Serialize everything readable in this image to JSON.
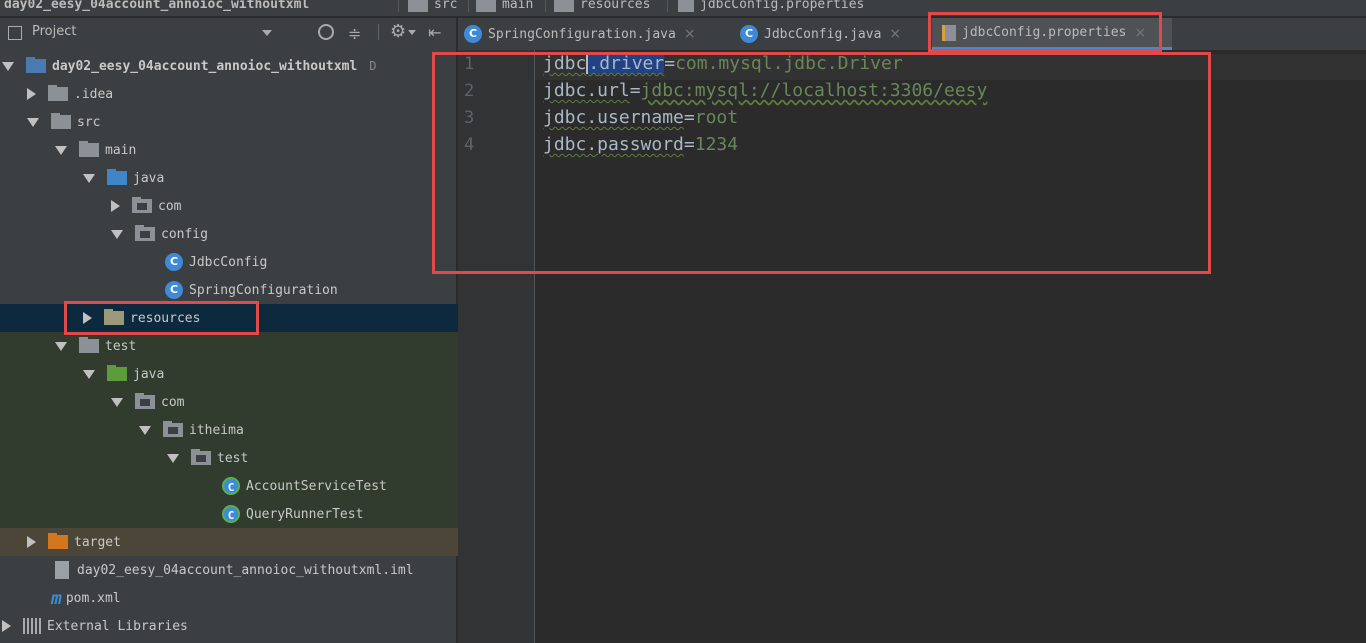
{
  "breadcrumb": {
    "project": "day02_eesy_04account_annoioc_withoutxml",
    "src": "src",
    "main": "main",
    "resources": "resources",
    "file": "jdbcConfig.properties"
  },
  "sidebar": {
    "header_title": "Project",
    "tree": [
      {
        "label": "day02_eesy_04account_annoioc_withoutxml",
        "suffix": "D"
      },
      {
        "label": ".idea"
      },
      {
        "label": "src"
      },
      {
        "label": "main"
      },
      {
        "label": "java"
      },
      {
        "label": "com"
      },
      {
        "label": "config"
      },
      {
        "label": "JdbcConfig",
        "badge": "C"
      },
      {
        "label": "SpringConfiguration",
        "badge": "C"
      },
      {
        "label": "resources"
      },
      {
        "label": "test"
      },
      {
        "label": "java"
      },
      {
        "label": "com"
      },
      {
        "label": "itheima"
      },
      {
        "label": "test"
      },
      {
        "label": "AccountServiceTest",
        "badge": "C"
      },
      {
        "label": "QueryRunnerTest",
        "badge": "C"
      },
      {
        "label": "target"
      },
      {
        "label": "day02_eesy_04account_annoioc_withoutxml.iml"
      },
      {
        "label": "pom.xml",
        "badge": "m"
      },
      {
        "label": "External Libraries"
      }
    ]
  },
  "tabs": [
    {
      "label": "SpringConfiguration.java",
      "badge": "C"
    },
    {
      "label": "JdbcConfig.java",
      "badge": "C"
    },
    {
      "label": "jdbcConfig.properties"
    }
  ],
  "close_glyph": "×",
  "editor": {
    "line_numbers": [
      "1",
      "2",
      "3",
      "4"
    ],
    "lines": [
      {
        "key_a": "jdbc",
        "key_b": ".",
        "key_c": "driver",
        "eq": "=",
        "value": "com.mysql.jdbc.Driver"
      },
      {
        "key": "jdbc.url",
        "eq": "=",
        "value": "jdbc:mysql://localhost:3306/eesy"
      },
      {
        "key": "jdbc.username",
        "eq": "=",
        "value": "root"
      },
      {
        "key": "jdbc.password",
        "eq": "=",
        "value": "1234"
      }
    ]
  },
  "colors": {
    "accent": "#4a88c7",
    "highlight_box": "#e24a4a",
    "selection": "#214283",
    "sidebar_selected": "#0d293e"
  }
}
